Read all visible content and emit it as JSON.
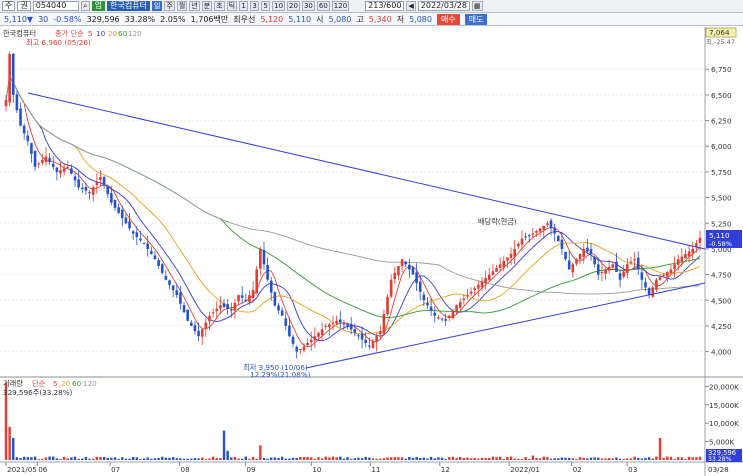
{
  "toolbar": {
    "menu": "주",
    "sub": "권",
    "code": "054040",
    "stock_name": "한국컴퓨터",
    "market_tag": "업",
    "periods": [
      "주",
      "월",
      "년",
      "분",
      "초",
      "틱"
    ],
    "minutes": [
      "1",
      "3",
      "5",
      "10",
      "20",
      "30",
      "60",
      "120"
    ],
    "count": "213/600",
    "date": "2022/03/28"
  },
  "quote": {
    "price": "5,110",
    "change": "30",
    "rate": "-0.58%",
    "volume": "329,596",
    "turnover": "33.28%",
    "vol_rate": "2.05%",
    "amount": "1,706백만",
    "pref_label": "최우선",
    "pref1": "5,120",
    "pref2": "5,110",
    "open_label": "시",
    "open": "5,080",
    "high_label": "고",
    "high": "5,340",
    "low_label": "저",
    "low": "5,080",
    "buy": "매수",
    "sell": "매도"
  },
  "price_panel": {
    "stock_label": "한국컴퓨터",
    "ma_label": "종가 단순",
    "ma_periods": [
      "5",
      "10",
      "20",
      "60",
      "120"
    ],
    "ma_colors": [
      "#e0413c",
      "#3a3ad0",
      "#e7a11b",
      "#2e9e2e",
      "#9a9a9a"
    ],
    "high_annot": "최고 6,960 (05/26)",
    "low_annot": "최저 3,950 (10/06)",
    "low_annot2": "12.29%(21.08%)",
    "mark_annot": "배당락(현금)",
    "axis_top": "7,064",
    "axis_top2": "최,-25.47",
    "price_tag": "5,110",
    "price_tag_rate": "-0.58%",
    "yticks": [
      "6,750",
      "6,500",
      "6,250",
      "6,000",
      "5,750",
      "5,500",
      "5,250",
      "5,000",
      "4,750",
      "4,500",
      "4,250",
      "4,000"
    ]
  },
  "volume_panel": {
    "label": "거래량",
    "ma_label": "단순",
    "ma_periods": [
      "5",
      "20",
      "60",
      "120"
    ],
    "current_label": "329,596주(33.28%)",
    "yticks": [
      "20,000K",
      "15,000K",
      "10,000K",
      "5,000K"
    ],
    "vol_tag": "329,596",
    "vol_tag_rate": "33.28%"
  },
  "x_axis": {
    "labels": [
      "2021/05",
      "06",
      "07",
      "08",
      "09",
      "10",
      "11",
      "12",
      "2022/01",
      "02",
      "03"
    ],
    "end_label": "03/28"
  },
  "chart_data": {
    "type": "candlestick",
    "months": [
      "2021/05",
      "06",
      "07",
      "08",
      "09",
      "10",
      "11",
      "12",
      "2022/01",
      "02",
      "03"
    ],
    "ylim": [
      3850,
      7064
    ],
    "high": {
      "value": 6960,
      "date": "05/26"
    },
    "low": {
      "value": 3950,
      "date": "10/06"
    },
    "close_points": [
      [
        0,
        6450
      ],
      [
        1,
        6900
      ],
      [
        2,
        6500
      ],
      [
        4,
        6200
      ],
      [
        6,
        6050
      ],
      [
        8,
        5800
      ],
      [
        11,
        5900
      ],
      [
        14,
        5750
      ],
      [
        17,
        5800
      ],
      [
        20,
        5600
      ],
      [
        23,
        5550
      ],
      [
        26,
        5700
      ],
      [
        29,
        5450
      ],
      [
        32,
        5300
      ],
      [
        35,
        5150
      ],
      [
        38,
        5050
      ],
      [
        41,
        4900
      ],
      [
        44,
        4700
      ],
      [
        47,
        4550
      ],
      [
        50,
        4300
      ],
      [
        53,
        4150
      ],
      [
        56,
        4350
      ],
      [
        59,
        4450
      ],
      [
        62,
        4400
      ],
      [
        64,
        4550
      ],
      [
        66,
        4500
      ],
      [
        68,
        4600
      ],
      [
        70,
        5000
      ],
      [
        72,
        4700
      ],
      [
        74,
        4450
      ],
      [
        76,
        4350
      ],
      [
        78,
        4150
      ],
      [
        80,
        4000
      ],
      [
        82,
        4050
      ],
      [
        85,
        4150
      ],
      [
        88,
        4250
      ],
      [
        91,
        4300
      ],
      [
        94,
        4250
      ],
      [
        97,
        4150
      ],
      [
        100,
        4050
      ],
      [
        103,
        4200
      ],
      [
        106,
        4700
      ],
      [
        109,
        4900
      ],
      [
        112,
        4750
      ],
      [
        115,
        4500
      ],
      [
        118,
        4350
      ],
      [
        121,
        4300
      ],
      [
        124,
        4450
      ],
      [
        127,
        4550
      ],
      [
        130,
        4650
      ],
      [
        133,
        4750
      ],
      [
        136,
        4850
      ],
      [
        139,
        4950
      ],
      [
        142,
        5100
      ],
      [
        145,
        5150
      ],
      [
        147,
        5200
      ],
      [
        149,
        5250
      ],
      [
        151,
        5150
      ],
      [
        153,
        5000
      ],
      [
        155,
        4800
      ],
      [
        157,
        4900
      ],
      [
        159,
        5000
      ],
      [
        161,
        4950
      ],
      [
        163,
        4750
      ],
      [
        165,
        4800
      ],
      [
        167,
        4850
      ],
      [
        169,
        4700
      ],
      [
        171,
        4850
      ],
      [
        173,
        4900
      ],
      [
        175,
        4700
      ],
      [
        177,
        4550
      ],
      [
        179,
        4700
      ],
      [
        181,
        4750
      ],
      [
        183,
        4800
      ],
      [
        185,
        4900
      ],
      [
        187,
        4950
      ],
      [
        189,
        5000
      ],
      [
        191,
        5110
      ]
    ],
    "volume": {
      "current": 329596,
      "ylim_k": [
        0,
        22000
      ],
      "spikes_k": [
        [
          0,
          21000
        ],
        [
          1,
          9000
        ],
        [
          2,
          6000
        ],
        [
          60,
          8000
        ],
        [
          61,
          2500
        ],
        [
          70,
          4000
        ],
        [
          145,
          1200
        ],
        [
          180,
          6000
        ]
      ]
    }
  }
}
